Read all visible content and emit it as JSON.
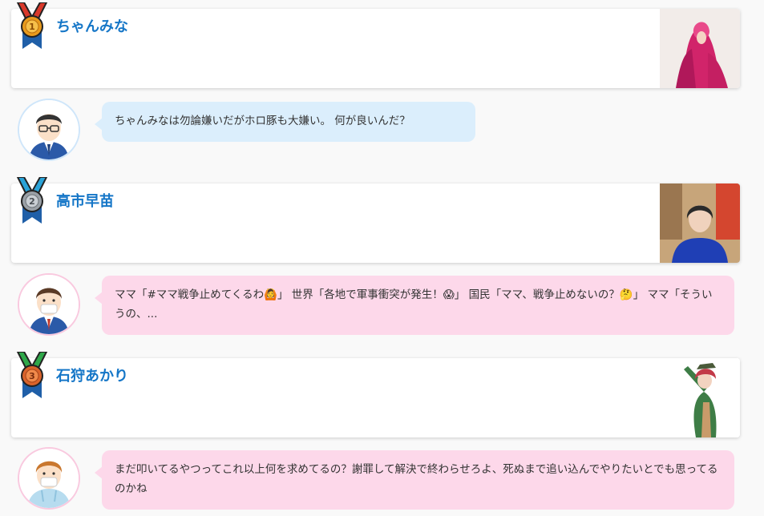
{
  "rankings": [
    {
      "rank": 1,
      "name": "ちゃんみな",
      "comment": "ちゃんみなは勿論嫌いだがホロ豚も大嫌い。 何が良いんだ？",
      "bubble_color": "#dbeefc",
      "medal_ribbon_color": "#d9392b",
      "medal_color": "#e89a1c"
    },
    {
      "rank": 2,
      "name": "高市早苗",
      "comment": "ママ「#ママ戦争止めてくるわ🙆」 世界「各地で軍事衝突が発生！😱」 国民「ママ、戦争止めないの？🤔」 ママ「そういうの、...",
      "bubble_color": "#fdd8ea",
      "medal_ribbon_color": "#2aa3d8",
      "medal_color": "#9aa0a6"
    },
    {
      "rank": 3,
      "name": "石狩あかり",
      "comment": "まだ叩いてるやつってこれ以上何を求めてるの？謝罪して解決で終わらせろよ、死ぬまで追い込んでやりたいとでも思ってるのかね",
      "bubble_color": "#fdd8ea",
      "medal_ribbon_color": "#2fa84a",
      "medal_color": "#d9632b"
    }
  ]
}
